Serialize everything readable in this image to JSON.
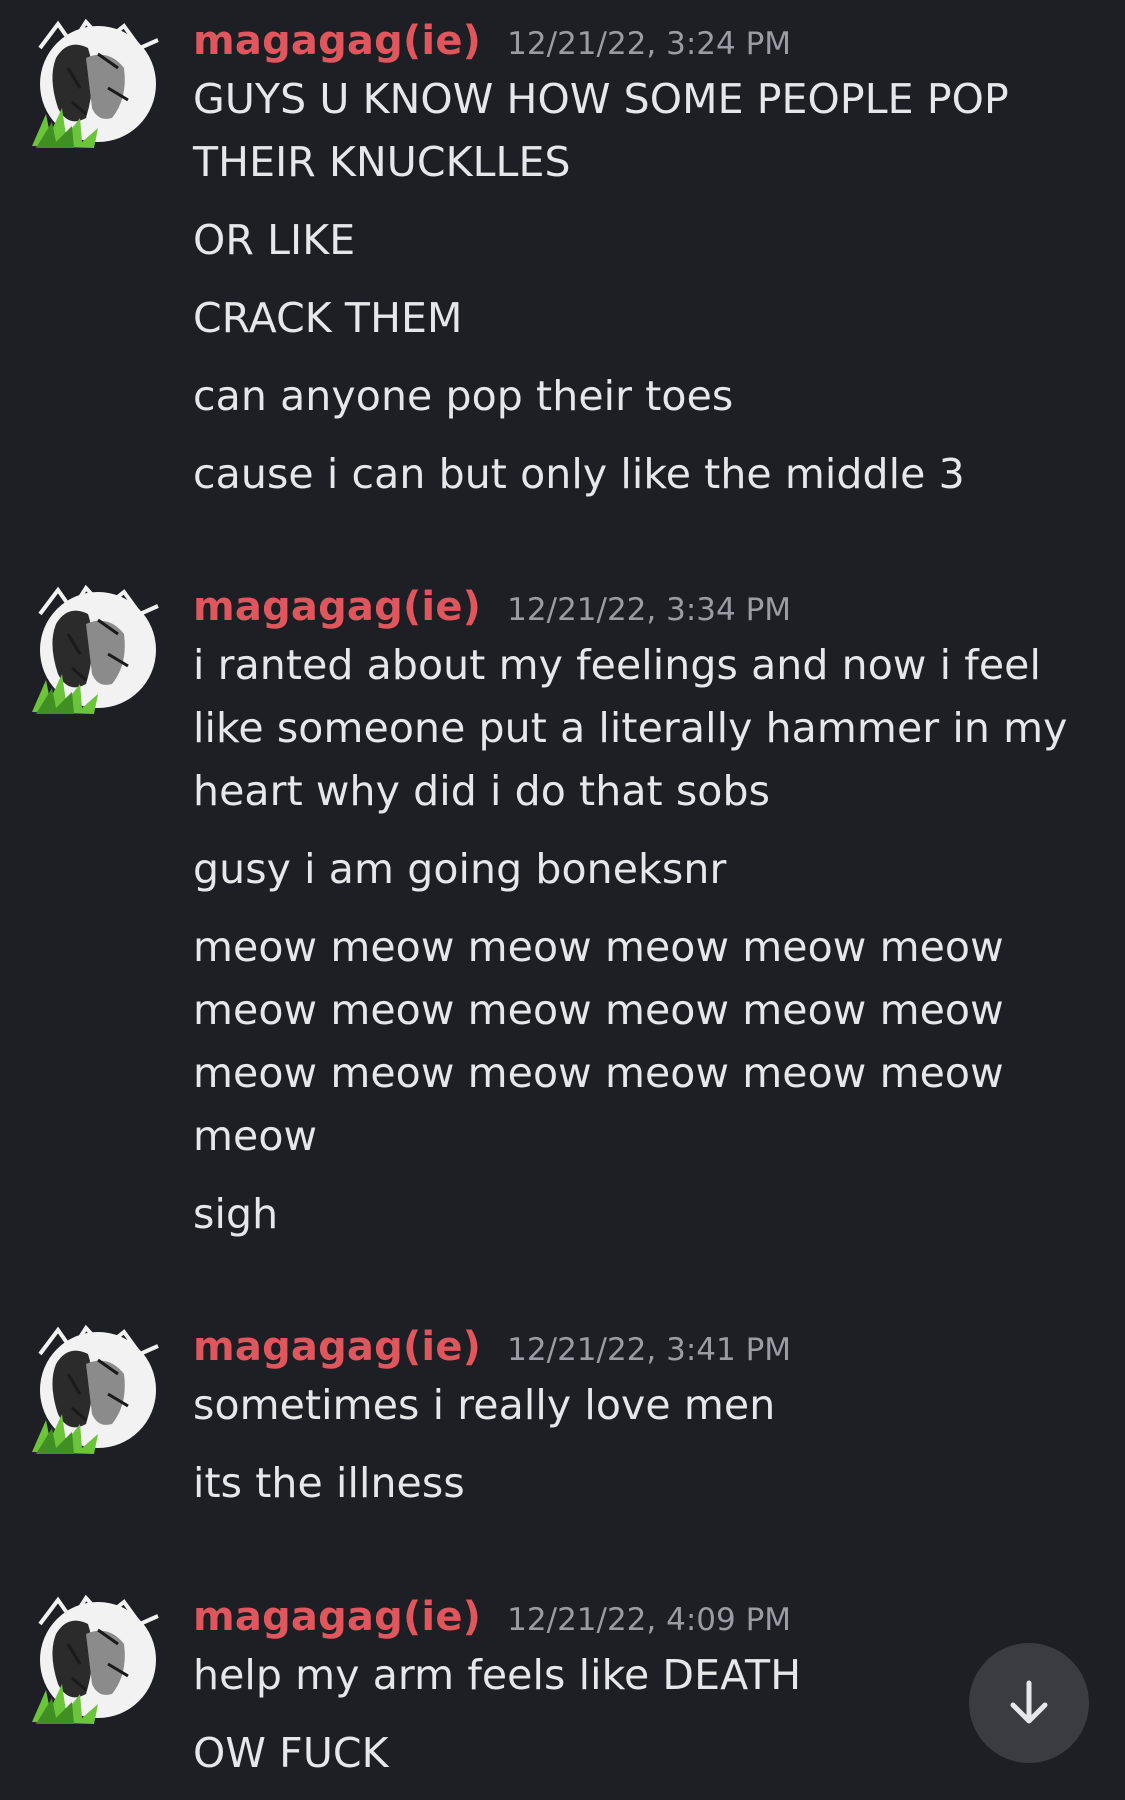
{
  "messages": [
    {
      "author": "magagag(ie)",
      "timestamp": "12/21/22, 3:24 PM",
      "lines": [
        "GUYS U KNOW HOW SOME PEOPLE POP THEIR KNUCKLLES",
        "OR LIKE",
        "CRACK THEM",
        "can anyone pop their toes",
        "cause i can but only like the middle 3"
      ]
    },
    {
      "author": "magagag(ie)",
      "timestamp": "12/21/22, 3:34 PM",
      "lines": [
        "i ranted about my feelings and now i feel like someone put a literally hammer in my heart why did i do that sobs",
        "gusy i am going boneksnr",
        "meow meow meow meow meow meow meow meow meow meow meow meow meow meow meow meow meow meow meow",
        "sigh"
      ]
    },
    {
      "author": "magagag(ie)",
      "timestamp": "12/21/22, 3:41 PM",
      "lines": [
        "sometimes i really love men",
        "its the illness"
      ]
    },
    {
      "author": "magagag(ie)",
      "timestamp": "12/21/22, 4:09 PM",
      "lines": [
        "help my arm feels like DEATH",
        "OW FUCK"
      ]
    }
  ],
  "colors": {
    "background": "#1e1f24",
    "username": "#e0565d",
    "timestamp": "#9a9ca3",
    "text": "#e6e7ea",
    "scroll_button": "#3a3c42"
  },
  "icons": {
    "avatar": "avatar-icon",
    "scroll": "arrow-down-icon"
  }
}
